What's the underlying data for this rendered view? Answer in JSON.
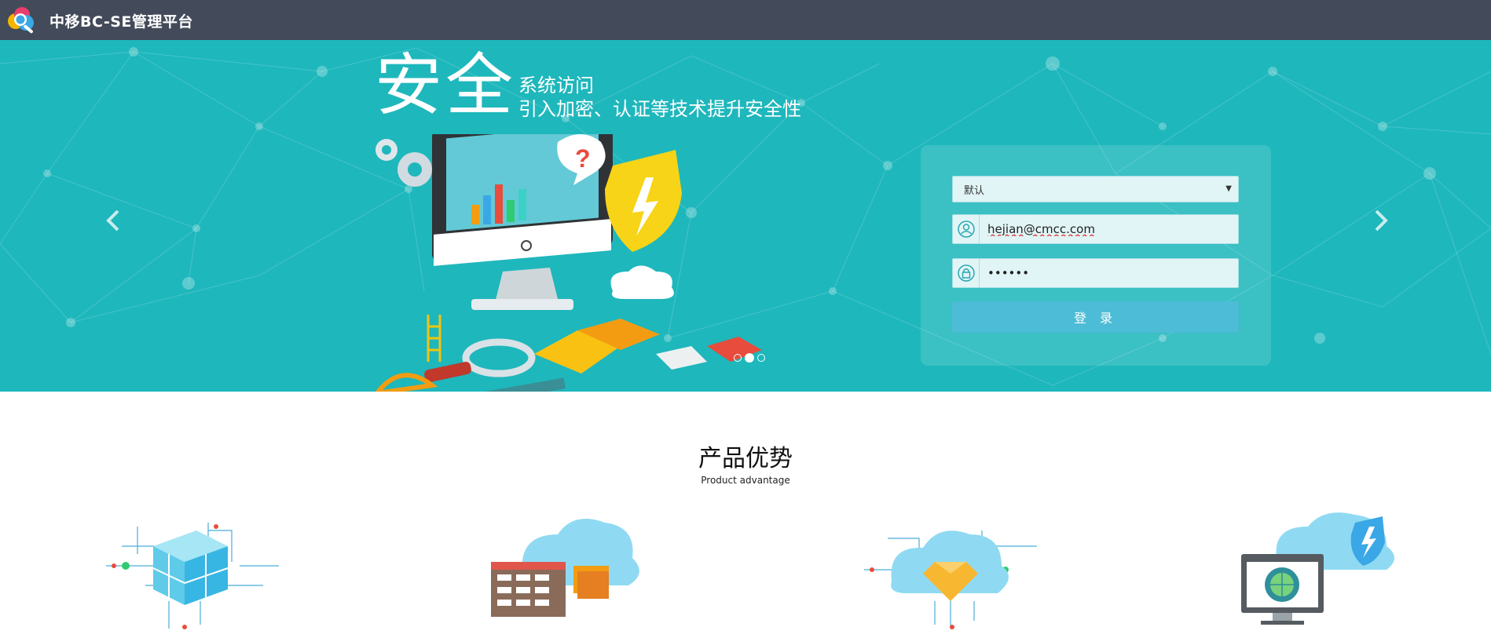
{
  "header": {
    "title": "中移BC-SE管理平台",
    "logo_icon": "search-globe-logo"
  },
  "banner": {
    "slogan_big": "安全",
    "slogan_line1": "系统访问",
    "slogan_line2": "引入加密、认证等技术提升安全性",
    "illustration": "security-monitor-illustration",
    "background_color": "#1eb7bc",
    "carousel_pages": 3,
    "carousel_active": 2
  },
  "login": {
    "tenant_select": {
      "selected": "默认"
    },
    "username": {
      "value": "hejian@cmcc.com",
      "icon": "user-icon"
    },
    "password": {
      "value": "••••••",
      "icon": "lock-icon"
    },
    "submit_label": "登 录",
    "button_color": "#4dbcd6"
  },
  "section": {
    "title": "产品优势",
    "subtitle": "Product advantage",
    "features": [
      {
        "icon": "cube-circuit-icon"
      },
      {
        "icon": "cloud-server-icon"
      },
      {
        "icon": "cloud-diamond-icon"
      },
      {
        "icon": "cloud-security-monitor-icon"
      }
    ]
  },
  "colors": {
    "header_bg": "#434a59",
    "accent": "#4dbcd6"
  }
}
